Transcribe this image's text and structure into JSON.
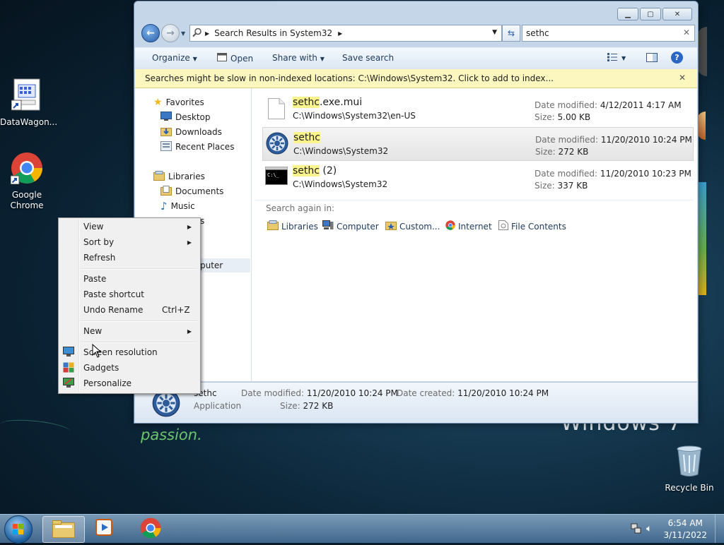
{
  "desktop": {
    "icons": [
      {
        "label": "DataWagon...",
        "icon": "datawagon-icon"
      },
      {
        "label": "Google\nChrome",
        "label_line1": "Google",
        "label_line2": "Chrome",
        "icon": "chrome-icon"
      },
      {
        "label": "Recycle Bin",
        "icon": "recycle-bin-icon"
      }
    ],
    "wallpaper_text": {
      "left": "passion.",
      "right": "Windows 7"
    }
  },
  "window": {
    "address": {
      "segments": [
        "Search Results in System32"
      ]
    },
    "search_value": "sethc",
    "toolbar": {
      "organize": "Organize",
      "open": "Open",
      "share_with": "Share with",
      "save_search": "Save search"
    },
    "infobar": "Searches might be slow in non-indexed locations: C:\\Windows\\System32. Click to add to index...",
    "nav": {
      "favorites": "Favorites",
      "desktop": "Desktop",
      "downloads": "Downloads",
      "recent_places": "Recent Places",
      "libraries": "Libraries",
      "documents": "Documents",
      "music": "Music",
      "pictures_partial": "s",
      "computer_partial": "puter"
    },
    "results": [
      {
        "name_hl": "sethc",
        "name_rest": ".exe.mui",
        "path": "C:\\Windows\\System32\\en-US",
        "date_label": "Date modified:",
        "date": "4/12/2011 4:17 AM",
        "size_label": "Size:",
        "size": "5.00 KB",
        "selected": false
      },
      {
        "name_hl": "sethc",
        "name_rest": "",
        "path": "C:\\Windows\\System32",
        "date_label": "Date modified:",
        "date": "11/20/2010 10:24 PM",
        "size_label": "Size:",
        "size": "272 KB",
        "selected": true
      },
      {
        "name_hl": "sethc",
        "name_rest": " (2)",
        "path": "C:\\Windows\\System32",
        "date_label": "Date modified:",
        "date": "11/20/2010 10:23 PM",
        "size_label": "Size:",
        "size": "337 KB",
        "selected": false
      }
    ],
    "search_again": {
      "label": "Search again in:",
      "items": [
        "Libraries",
        "Computer",
        "Custom...",
        "Internet",
        "File Contents"
      ]
    },
    "details": {
      "name": "sethc",
      "type": "Application",
      "date_modified_label": "Date modified:",
      "date_modified": "11/20/2010 10:24 PM",
      "date_created_label": "Date created:",
      "date_created": "11/20/2010 10:24 PM",
      "size_label": "Size:",
      "size": "272 KB"
    }
  },
  "context_menu": {
    "view": "View",
    "sort_by": "Sort by",
    "refresh": "Refresh",
    "paste": "Paste",
    "paste_shortcut": "Paste shortcut",
    "undo_rename": "Undo Rename",
    "undo_shortcut": "Ctrl+Z",
    "new": "New",
    "screen_resolution": "Screen resolution",
    "gadgets": "Gadgets",
    "personalize": "Personalize"
  },
  "taskbar": {
    "time": "6:54 AM",
    "date": "3/11/2022"
  },
  "colors": {
    "highlight": "#fbf38c",
    "infobar": "#fcf6bf",
    "accent": "#2a5fa8"
  }
}
